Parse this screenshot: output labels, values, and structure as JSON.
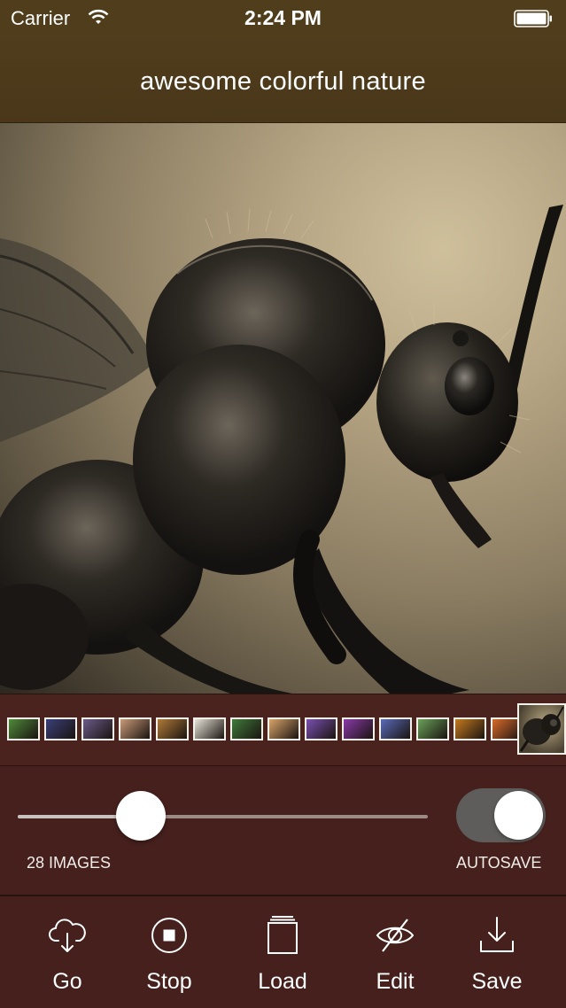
{
  "status_bar": {
    "carrier": "Carrier",
    "time": "2:24 PM",
    "wifi_icon": "wifi-icon",
    "battery_icon": "battery-icon"
  },
  "nav": {
    "title": "awesome colorful nature"
  },
  "main_image": {
    "subject": "sepia macro photograph of an insect"
  },
  "thumbnails": [
    {
      "name": "thumb-1",
      "color": "#4f8a3a"
    },
    {
      "name": "thumb-2",
      "color": "#3b3f7a"
    },
    {
      "name": "thumb-3",
      "color": "#6a5a8a"
    },
    {
      "name": "thumb-4",
      "color": "#c99a78"
    },
    {
      "name": "thumb-5",
      "color": "#b07a38"
    },
    {
      "name": "thumb-6",
      "color": "#e8e4d8"
    },
    {
      "name": "thumb-7",
      "color": "#3f7a3a"
    },
    {
      "name": "thumb-8",
      "color": "#d9a46a"
    },
    {
      "name": "thumb-9",
      "color": "#7a4fb0"
    },
    {
      "name": "thumb-10",
      "color": "#8a3aa8"
    },
    {
      "name": "thumb-11",
      "color": "#5a6ab8"
    },
    {
      "name": "thumb-12",
      "color": "#6aa05a"
    },
    {
      "name": "thumb-13",
      "color": "#c47a1e"
    },
    {
      "name": "thumb-14",
      "color": "#d86a2a"
    }
  ],
  "controls": {
    "slider_label": "28 IMAGES",
    "slider_value": 0.3,
    "toggle_label": "AUTOSAVE",
    "toggle_on": true
  },
  "toolbar": {
    "items": [
      {
        "label": "Go",
        "icon": "cloud-download-icon"
      },
      {
        "label": "Stop",
        "icon": "stop-icon"
      },
      {
        "label": "Load",
        "icon": "stack-icon"
      },
      {
        "label": "Edit",
        "icon": "eye-slash-icon"
      },
      {
        "label": "Save",
        "icon": "download-icon"
      }
    ]
  },
  "colors": {
    "nav_background": "#4f3d1c",
    "panel_background": "#45201c",
    "accent": "#ffffff"
  }
}
